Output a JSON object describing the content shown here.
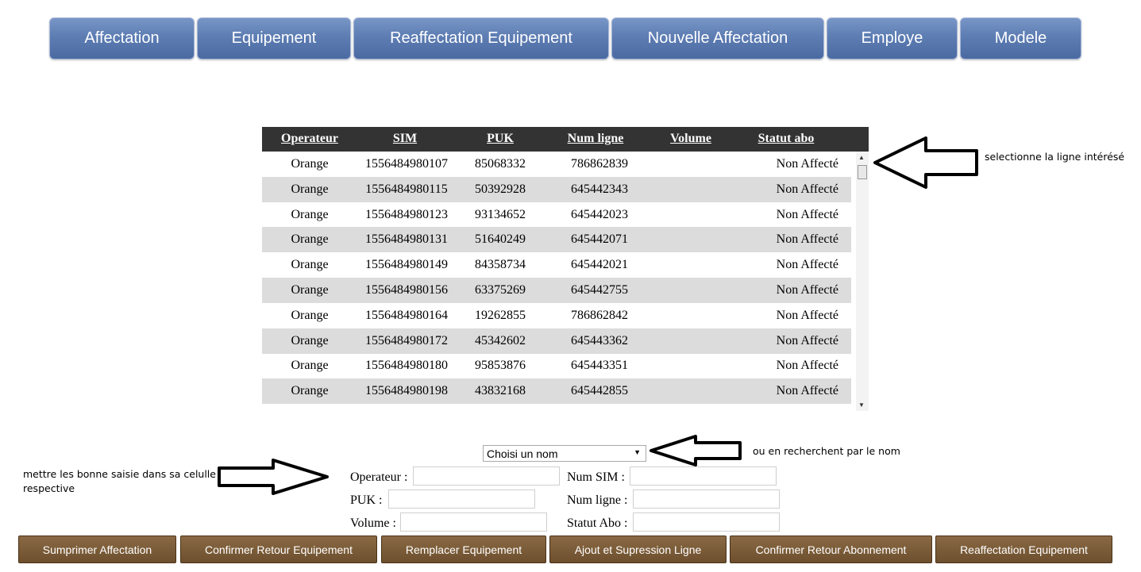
{
  "nav": {
    "items": [
      {
        "label": "Affectation"
      },
      {
        "label": "Equipement"
      },
      {
        "label": "Reaffectation Equipement"
      },
      {
        "label": "Nouvelle Affectation"
      },
      {
        "label": "Employe"
      },
      {
        "label": "Modele"
      }
    ]
  },
  "grid": {
    "columns": [
      "Operateur",
      "SIM",
      "PUK",
      "Num ligne",
      "Volume",
      "Statut abo"
    ],
    "rows": [
      [
        "Orange",
        "1556484980107",
        "85068332",
        "786862839",
        "",
        "Non Affecté"
      ],
      [
        "Orange",
        "1556484980115",
        "50392928",
        "645442343",
        "",
        "Non Affecté"
      ],
      [
        "Orange",
        "1556484980123",
        "93134652",
        "645442023",
        "",
        "Non Affecté"
      ],
      [
        "Orange",
        "1556484980131",
        "51640249",
        "645442071",
        "",
        "Non Affecté"
      ],
      [
        "Orange",
        "1556484980149",
        "84358734",
        "645442021",
        "",
        "Non Affecté"
      ],
      [
        "Orange",
        "1556484980156",
        "63375269",
        "645442755",
        "",
        "Non Affecté"
      ],
      [
        "Orange",
        "1556484980164",
        "19262855",
        "786862842",
        "",
        "Non Affecté"
      ],
      [
        "Orange",
        "1556484980172",
        "45342602",
        "645443362",
        "",
        "Non Affecté"
      ],
      [
        "Orange",
        "1556484980180",
        "95853876",
        "645443351",
        "",
        "Non Affecté"
      ],
      [
        "Orange",
        "1556484980198",
        "43832168",
        "645442855",
        "",
        "Non Affecté"
      ]
    ]
  },
  "annotations": {
    "select_row": "selectionne la ligne intérésé",
    "search_name": "ou en recherchent par le nom",
    "fill_fields": "mettre les bonne saisie dans sa celulle respective"
  },
  "form": {
    "name_select": {
      "value": "Choisi un nom"
    },
    "operateur_label": "Operateur :",
    "operateur_value": "",
    "num_sim_label": "Num SIM :",
    "num_sim_value": "",
    "puk_label": "PUK :",
    "puk_value": "",
    "num_ligne_label": "Num ligne :",
    "num_ligne_value": "",
    "volume_label": "Volume :",
    "volume_value": "",
    "statut_abo_label": "Statut Abo :",
    "statut_abo_value": ""
  },
  "actions": [
    {
      "label": "Sumprimer Affectation"
    },
    {
      "label": "Confirmer Retour Equipement"
    },
    {
      "label": "Remplacer Equipement"
    },
    {
      "label": "Ajout et Supression Ligne"
    },
    {
      "label": "Confirmer Retour Abonnement"
    },
    {
      "label": "Reaffectation Equipement"
    }
  ],
  "colors": {
    "nav_bg": "#5d7db3",
    "table_header_bg": "#333333",
    "row_alt_bg": "#dcdcdc",
    "action_bg": "#6d4f2e"
  }
}
